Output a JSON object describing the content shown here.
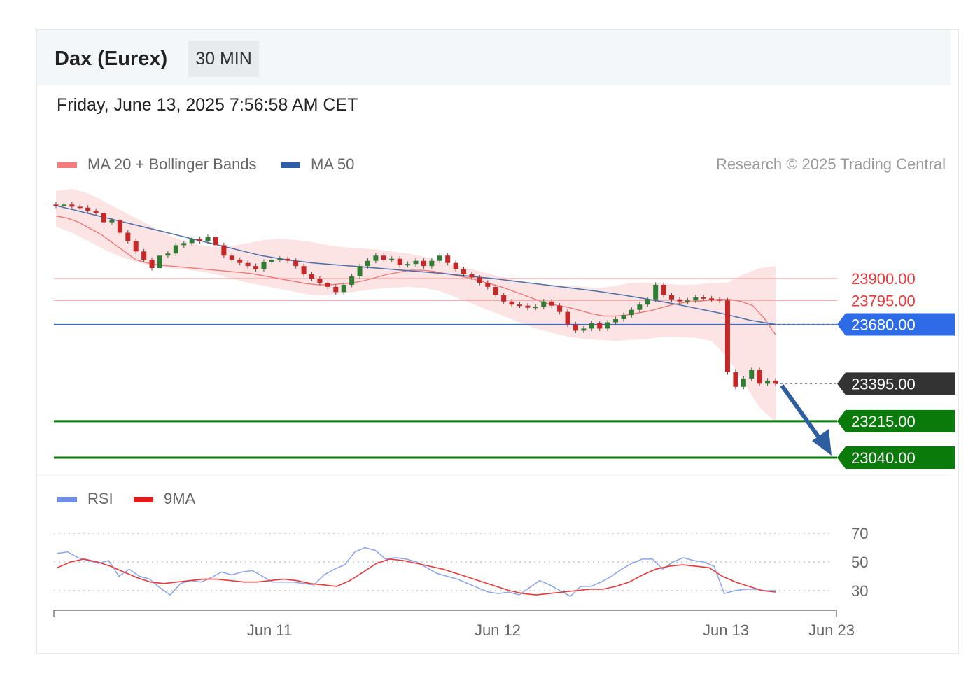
{
  "header": {
    "instrument": "Dax (Eurex)",
    "timeframe": "30 MIN",
    "datetime": "Friday, June 13, 2025 7:56:58 AM CET"
  },
  "legend": {
    "ma20": {
      "label": "MA 20 + Bollinger Bands",
      "color": "#f47c7c"
    },
    "ma50": {
      "label": "MA 50",
      "color": "#2d5fa6"
    },
    "rsi": {
      "label": "RSI",
      "color": "#6e8ee8"
    },
    "rsi_ma": {
      "label": "9MA",
      "color": "#e31b1b"
    }
  },
  "credit": "Research © 2025 Trading Central",
  "chart_data": [
    {
      "type": "candlestick",
      "ylim": [
        22990,
        24000
      ],
      "levels": [
        {
          "value": 23900,
          "label": "23900.00",
          "kind": "resistance",
          "color": "#e8393a",
          "line": "#f5a3a3"
        },
        {
          "value": 23795,
          "label": "23795.00",
          "kind": "resistance",
          "color": "#e8393a",
          "line": "#f5a3a3"
        },
        {
          "value": 23680,
          "label": "23680.00",
          "kind": "pivot",
          "color": "#2e6be6",
          "line": "#2e6be6"
        },
        {
          "value": 23395,
          "label": "23395.00",
          "kind": "last",
          "color": "#333333",
          "line": "#888888"
        },
        {
          "value": 23215,
          "label": "23215.00",
          "kind": "support",
          "color": "#0a7a0a",
          "line": "#0a7a0a"
        },
        {
          "value": 23040,
          "label": "23040.00",
          "kind": "support",
          "color": "#0a7a0a",
          "line": "#0a7a0a"
        }
      ],
      "close": [
        24250,
        24255,
        24245,
        24240,
        24225,
        24215,
        24170,
        24180,
        24120,
        24080,
        24030,
        23990,
        23950,
        24010,
        24020,
        24060,
        24070,
        24090,
        24080,
        24100,
        24060,
        24010,
        23990,
        23975,
        23960,
        23945,
        23980,
        23990,
        23995,
        23985,
        23960,
        23920,
        23900,
        23880,
        23860,
        23835,
        23870,
        23910,
        23960,
        23985,
        24010,
        23990,
        23995,
        23965,
        23970,
        23985,
        23960,
        23985,
        24010,
        23975,
        23945,
        23920,
        23905,
        23880,
        23860,
        23820,
        23790,
        23775,
        23770,
        23760,
        23765,
        23790,
        23770,
        23740,
        23680,
        23650,
        23660,
        23685,
        23660,
        23690,
        23705,
        23725,
        23750,
        23775,
        23800,
        23870,
        23820,
        23800,
        23790,
        23795,
        23810,
        23805,
        23800,
        23795,
        23450,
        23380,
        23420,
        23460,
        23395,
        23410,
        23395
      ],
      "ma20": [
        24200,
        24190,
        24170,
        24140,
        24110,
        24070,
        24030,
        23990,
        23975,
        23965,
        23960,
        23955,
        23950,
        23945,
        23940,
        23935,
        23930,
        23925,
        23915,
        23905,
        23895,
        23885,
        23875,
        23870,
        23870,
        23875,
        23880,
        23890,
        23905,
        23920,
        23930,
        23940,
        23940,
        23935,
        23925,
        23915,
        23905,
        23890,
        23875,
        23860,
        23840,
        23820,
        23800,
        23780,
        23770,
        23760,
        23745,
        23730,
        23720,
        23720,
        23725,
        23735,
        23745,
        23760,
        23775,
        23785,
        23790,
        23795,
        23800,
        23800,
        23790,
        23770,
        23710,
        23630
      ],
      "ma50": [
        24250,
        24220,
        24190,
        24160,
        24130,
        24100,
        24070,
        24040,
        24010,
        23990,
        23975,
        23965,
        23955,
        23945,
        23935,
        23925,
        23912,
        23900,
        23885,
        23870,
        23855,
        23840,
        23822,
        23802,
        23780,
        23755,
        23730,
        23700,
        23680
      ],
      "bb_upper": [
        24320,
        24330,
        24310,
        24270,
        24230,
        24190,
        24150,
        24110,
        24080,
        24060,
        24050,
        24055,
        24070,
        24085,
        24090,
        24085,
        24075,
        24060,
        24050,
        24045,
        24040,
        24030,
        24020,
        24005,
        23985,
        23965,
        23945,
        23925,
        23905,
        23890,
        23875,
        23870,
        23865,
        23860,
        23855,
        23865,
        23880,
        23880,
        23875,
        23870,
        23870,
        23880,
        23880,
        23920,
        23950,
        23960
      ],
      "bb_lower": [
        24150,
        24120,
        24080,
        24040,
        24005,
        23980,
        23960,
        23950,
        23945,
        23935,
        23920,
        23900,
        23880,
        23865,
        23850,
        23835,
        23820,
        23820,
        23830,
        23840,
        23850,
        23855,
        23860,
        23855,
        23840,
        23810,
        23780,
        23750,
        23720,
        23690,
        23660,
        23640,
        23620,
        23610,
        23605,
        23600,
        23605,
        23610,
        23620,
        23620,
        23615,
        23600,
        23520,
        23400,
        23280,
        23210
      ]
    },
    {
      "type": "line",
      "name_ticks": [
        "70",
        "50",
        "30"
      ],
      "x_ticks": [
        "Jun 11",
        "Jun 12",
        "Jun 13",
        "Jun 23"
      ],
      "ylim": [
        20,
        78
      ],
      "series": [
        {
          "name": "RSI",
          "values": [
            56,
            57,
            53,
            51,
            49,
            51,
            40,
            45,
            40,
            38,
            32,
            27,
            35,
            37,
            36,
            39,
            43,
            41,
            43,
            44,
            40,
            36,
            36,
            36,
            35,
            34,
            41,
            45,
            48,
            57,
            60,
            58,
            52,
            53,
            52,
            50,
            46,
            42,
            40,
            38,
            35,
            32,
            29,
            28,
            29,
            27,
            32,
            37,
            34,
            30,
            26,
            33,
            33,
            36,
            40,
            45,
            49,
            52,
            52,
            45,
            50,
            53,
            51,
            50,
            47,
            28,
            30,
            31,
            31,
            30,
            30
          ]
        },
        {
          "name": "9MA",
          "values": [
            46,
            50,
            52,
            50,
            47,
            43,
            39,
            36,
            35,
            36,
            37,
            38,
            38,
            37,
            36,
            36,
            37,
            38,
            37,
            35,
            34,
            33,
            37,
            43,
            49,
            52,
            51,
            49,
            47,
            45,
            42,
            39,
            36,
            33,
            30,
            28,
            27,
            28,
            29,
            30,
            31,
            31,
            33,
            36,
            41,
            45,
            47,
            48,
            47,
            46,
            40,
            36,
            33,
            30,
            29
          ]
        }
      ]
    }
  ]
}
